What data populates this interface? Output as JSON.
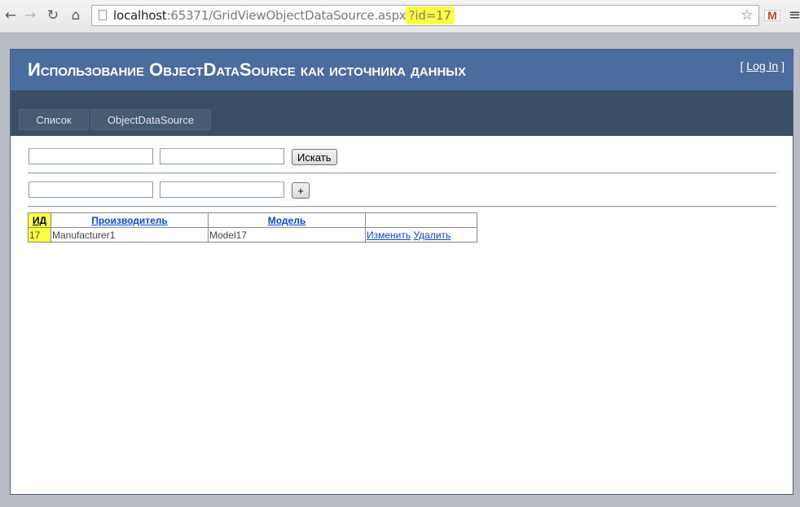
{
  "browser": {
    "url_host": "localhost",
    "url_path": ":65371/GridViewObjectDataSource.aspx",
    "url_query": "?id=17"
  },
  "site": {
    "title": "Использование ObjectDataSource как источника данных",
    "login_open": "[ ",
    "login_label": "Log In",
    "login_close": " ]"
  },
  "nav": {
    "items": [
      "Список",
      "ObjectDataSource"
    ]
  },
  "search": {
    "field1_value": "",
    "field2_value": "",
    "button_label": "Искать"
  },
  "add": {
    "field1_value": "",
    "field2_value": "",
    "button_label": "+"
  },
  "grid": {
    "headers": [
      "ИД",
      "Производитель",
      "Модель",
      ""
    ],
    "rows": [
      {
        "id": "17",
        "manufacturer": "Manufacturer1",
        "model": "Model17",
        "edit": "Изменить",
        "delete": "Удалить"
      }
    ]
  },
  "colors": {
    "header_bg": "#4b6c9e",
    "nav_bg": "#3a4f63",
    "highlight": "#ffff40",
    "link": "#034af3"
  },
  "icons": [
    "back-icon",
    "forward-icon",
    "reload-icon",
    "home-icon",
    "page-icon",
    "star-icon",
    "gmail-icon",
    "menu-icon"
  ]
}
